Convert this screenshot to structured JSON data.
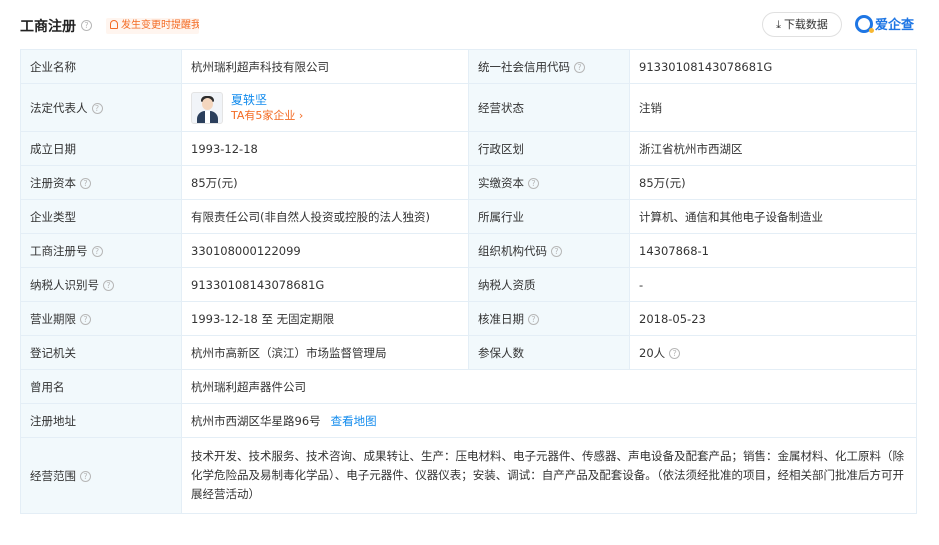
{
  "header": {
    "title": "工商注册",
    "notify_label": "发生变更时提醒我",
    "download_label": "下载数据",
    "brand_name": "爱企查"
  },
  "rows": {
    "name": {
      "label": "企业名称",
      "value": "杭州瑞利超声科技有限公司",
      "label2": "统一社会信用代码",
      "value2": "91330108143078681G"
    },
    "legal": {
      "label": "法定代表人",
      "person_name": "夏轶坚",
      "person_sub": "TA有5家企业 ›",
      "label2": "经营状态",
      "value2": "注销"
    },
    "founded": {
      "label": "成立日期",
      "value": "1993-12-18",
      "label2": "行政区划",
      "value2": "浙江省杭州市西湖区"
    },
    "capital": {
      "label": "注册资本",
      "value": "85万(元)",
      "label2": "实缴资本",
      "value2": "85万(元)"
    },
    "type": {
      "label": "企业类型",
      "value": "有限责任公司(非自然人投资或控股的法人独资)",
      "label2": "所属行业",
      "value2": "计算机、通信和其他电子设备制造业"
    },
    "regno": {
      "label": "工商注册号",
      "value": "330108000122099",
      "label2": "组织机构代码",
      "value2": "14307868-1"
    },
    "taxid": {
      "label": "纳税人识别号",
      "value": "91330108143078681G",
      "label2": "纳税人资质",
      "value2": "-"
    },
    "term": {
      "label": "营业期限",
      "value": "1993-12-18 至 无固定期限",
      "label2": "核准日期",
      "value2": "2018-05-23"
    },
    "authority": {
      "label": "登记机关",
      "value": "杭州市高新区（滨江）市场监督管理局",
      "label2": "参保人数",
      "value2": "20人"
    },
    "formername": {
      "label": "曾用名",
      "value": "杭州瑞利超声器件公司"
    },
    "address": {
      "label": "注册地址",
      "value": "杭州市西湖区华星路96号",
      "map_link": "查看地图"
    },
    "scope": {
      "label": "经营范围",
      "value": "技术开发、技术服务、技术咨询、成果转让、生产：压电材料、电子元器件、传感器、声电设备及配套产品；销售：金属材料、化工原料（除化学危险品及易制毒化学品）、电子元器件、仪器仪表；安装、调试：自产产品及配套设备。（依法须经批准的项目，经相关部门批准后方可开展经营活动）"
    }
  },
  "colors": {
    "accent": "#128bed",
    "warning": "#f36b24",
    "label_bg": "#f2f9fc",
    "border": "#e4eef6"
  },
  "icons": [
    "help-circle-icon",
    "bell-icon",
    "download-icon",
    "chevron-right-icon",
    "brand-logo-icon"
  ]
}
